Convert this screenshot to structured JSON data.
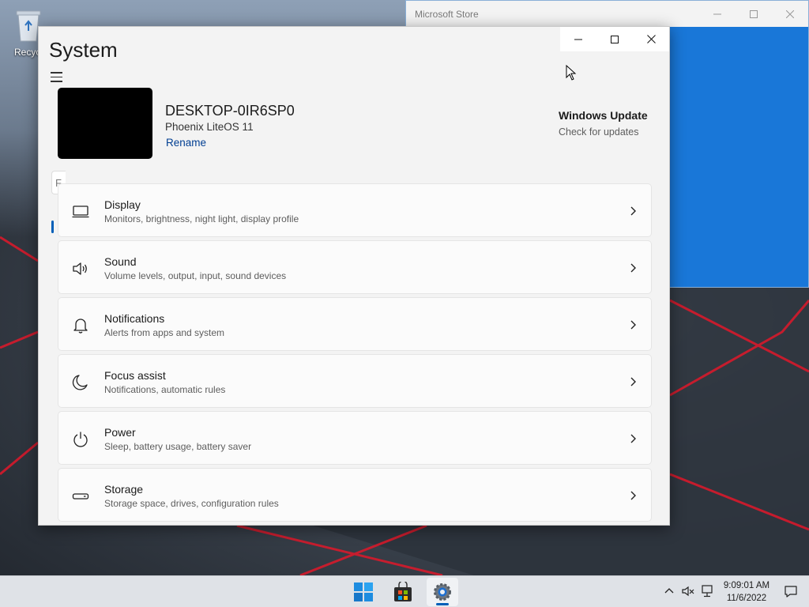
{
  "desktop": {
    "recycle_bin_label": "Recycl"
  },
  "store_window": {
    "title": "Microsoft Store"
  },
  "settings": {
    "page_title": "System",
    "search_stub_text": "F",
    "device": {
      "name": "DESKTOP-0IR6SP0",
      "os": "Phoenix LiteOS 11",
      "rename_label": "Rename"
    },
    "windows_update": {
      "title": "Windows Update",
      "subtitle": "Check for updates"
    },
    "items": [
      {
        "title": "Display",
        "subtitle": "Monitors, brightness, night light, display profile",
        "icon": "display-icon"
      },
      {
        "title": "Sound",
        "subtitle": "Volume levels, output, input, sound devices",
        "icon": "speaker-icon"
      },
      {
        "title": "Notifications",
        "subtitle": "Alerts from apps and system",
        "icon": "bell-icon"
      },
      {
        "title": "Focus assist",
        "subtitle": "Notifications, automatic rules",
        "icon": "moon-icon"
      },
      {
        "title": "Power",
        "subtitle": "Sleep, battery usage, battery saver",
        "icon": "power-icon"
      },
      {
        "title": "Storage",
        "subtitle": "Storage space, drives, configuration rules",
        "icon": "drive-icon"
      }
    ]
  },
  "taskbar": {
    "apps": [
      "start-icon",
      "store-icon",
      "settings-gear-icon"
    ],
    "clock": {
      "time": "9:09:01 AM",
      "date": "11/6/2022"
    }
  },
  "colors": {
    "accent": "#005fb8",
    "link": "#003e92",
    "store_blue": "#1977d8"
  }
}
